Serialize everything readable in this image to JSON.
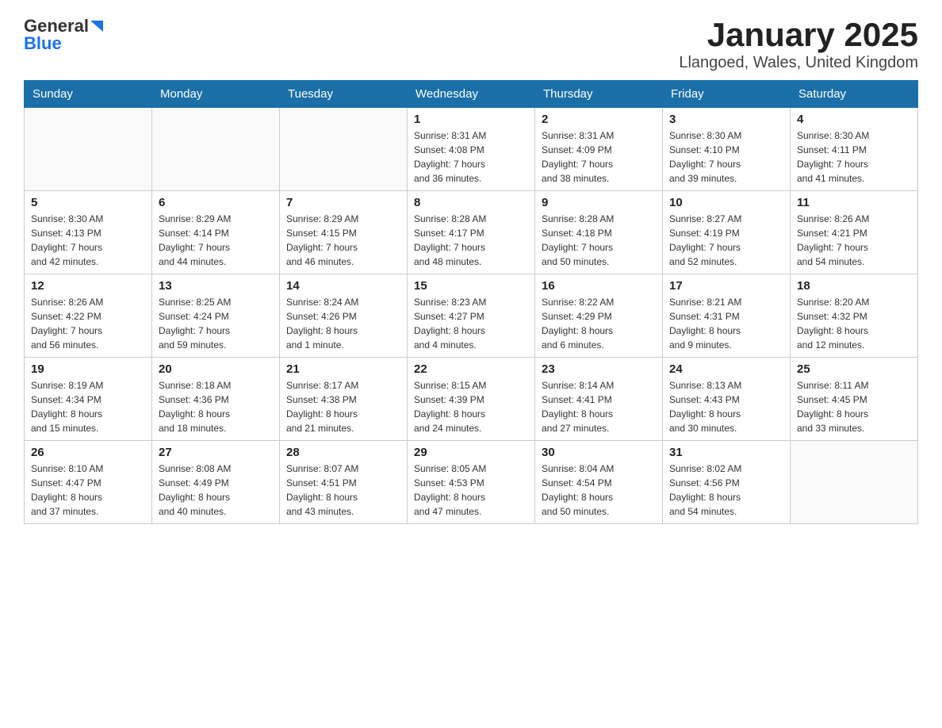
{
  "header": {
    "logo": {
      "general": "General",
      "blue": "Blue"
    },
    "title": "January 2025",
    "subtitle": "Llangoed, Wales, United Kingdom"
  },
  "weekdays": [
    "Sunday",
    "Monday",
    "Tuesday",
    "Wednesday",
    "Thursday",
    "Friday",
    "Saturday"
  ],
  "weeks": [
    [
      {
        "day": "",
        "info": ""
      },
      {
        "day": "",
        "info": ""
      },
      {
        "day": "",
        "info": ""
      },
      {
        "day": "1",
        "info": "Sunrise: 8:31 AM\nSunset: 4:08 PM\nDaylight: 7 hours\nand 36 minutes."
      },
      {
        "day": "2",
        "info": "Sunrise: 8:31 AM\nSunset: 4:09 PM\nDaylight: 7 hours\nand 38 minutes."
      },
      {
        "day": "3",
        "info": "Sunrise: 8:30 AM\nSunset: 4:10 PM\nDaylight: 7 hours\nand 39 minutes."
      },
      {
        "day": "4",
        "info": "Sunrise: 8:30 AM\nSunset: 4:11 PM\nDaylight: 7 hours\nand 41 minutes."
      }
    ],
    [
      {
        "day": "5",
        "info": "Sunrise: 8:30 AM\nSunset: 4:13 PM\nDaylight: 7 hours\nand 42 minutes."
      },
      {
        "day": "6",
        "info": "Sunrise: 8:29 AM\nSunset: 4:14 PM\nDaylight: 7 hours\nand 44 minutes."
      },
      {
        "day": "7",
        "info": "Sunrise: 8:29 AM\nSunset: 4:15 PM\nDaylight: 7 hours\nand 46 minutes."
      },
      {
        "day": "8",
        "info": "Sunrise: 8:28 AM\nSunset: 4:17 PM\nDaylight: 7 hours\nand 48 minutes."
      },
      {
        "day": "9",
        "info": "Sunrise: 8:28 AM\nSunset: 4:18 PM\nDaylight: 7 hours\nand 50 minutes."
      },
      {
        "day": "10",
        "info": "Sunrise: 8:27 AM\nSunset: 4:19 PM\nDaylight: 7 hours\nand 52 minutes."
      },
      {
        "day": "11",
        "info": "Sunrise: 8:26 AM\nSunset: 4:21 PM\nDaylight: 7 hours\nand 54 minutes."
      }
    ],
    [
      {
        "day": "12",
        "info": "Sunrise: 8:26 AM\nSunset: 4:22 PM\nDaylight: 7 hours\nand 56 minutes."
      },
      {
        "day": "13",
        "info": "Sunrise: 8:25 AM\nSunset: 4:24 PM\nDaylight: 7 hours\nand 59 minutes."
      },
      {
        "day": "14",
        "info": "Sunrise: 8:24 AM\nSunset: 4:26 PM\nDaylight: 8 hours\nand 1 minute."
      },
      {
        "day": "15",
        "info": "Sunrise: 8:23 AM\nSunset: 4:27 PM\nDaylight: 8 hours\nand 4 minutes."
      },
      {
        "day": "16",
        "info": "Sunrise: 8:22 AM\nSunset: 4:29 PM\nDaylight: 8 hours\nand 6 minutes."
      },
      {
        "day": "17",
        "info": "Sunrise: 8:21 AM\nSunset: 4:31 PM\nDaylight: 8 hours\nand 9 minutes."
      },
      {
        "day": "18",
        "info": "Sunrise: 8:20 AM\nSunset: 4:32 PM\nDaylight: 8 hours\nand 12 minutes."
      }
    ],
    [
      {
        "day": "19",
        "info": "Sunrise: 8:19 AM\nSunset: 4:34 PM\nDaylight: 8 hours\nand 15 minutes."
      },
      {
        "day": "20",
        "info": "Sunrise: 8:18 AM\nSunset: 4:36 PM\nDaylight: 8 hours\nand 18 minutes."
      },
      {
        "day": "21",
        "info": "Sunrise: 8:17 AM\nSunset: 4:38 PM\nDaylight: 8 hours\nand 21 minutes."
      },
      {
        "day": "22",
        "info": "Sunrise: 8:15 AM\nSunset: 4:39 PM\nDaylight: 8 hours\nand 24 minutes."
      },
      {
        "day": "23",
        "info": "Sunrise: 8:14 AM\nSunset: 4:41 PM\nDaylight: 8 hours\nand 27 minutes."
      },
      {
        "day": "24",
        "info": "Sunrise: 8:13 AM\nSunset: 4:43 PM\nDaylight: 8 hours\nand 30 minutes."
      },
      {
        "day": "25",
        "info": "Sunrise: 8:11 AM\nSunset: 4:45 PM\nDaylight: 8 hours\nand 33 minutes."
      }
    ],
    [
      {
        "day": "26",
        "info": "Sunrise: 8:10 AM\nSunset: 4:47 PM\nDaylight: 8 hours\nand 37 minutes."
      },
      {
        "day": "27",
        "info": "Sunrise: 8:08 AM\nSunset: 4:49 PM\nDaylight: 8 hours\nand 40 minutes."
      },
      {
        "day": "28",
        "info": "Sunrise: 8:07 AM\nSunset: 4:51 PM\nDaylight: 8 hours\nand 43 minutes."
      },
      {
        "day": "29",
        "info": "Sunrise: 8:05 AM\nSunset: 4:53 PM\nDaylight: 8 hours\nand 47 minutes."
      },
      {
        "day": "30",
        "info": "Sunrise: 8:04 AM\nSunset: 4:54 PM\nDaylight: 8 hours\nand 50 minutes."
      },
      {
        "day": "31",
        "info": "Sunrise: 8:02 AM\nSunset: 4:56 PM\nDaylight: 8 hours\nand 54 minutes."
      },
      {
        "day": "",
        "info": ""
      }
    ]
  ]
}
